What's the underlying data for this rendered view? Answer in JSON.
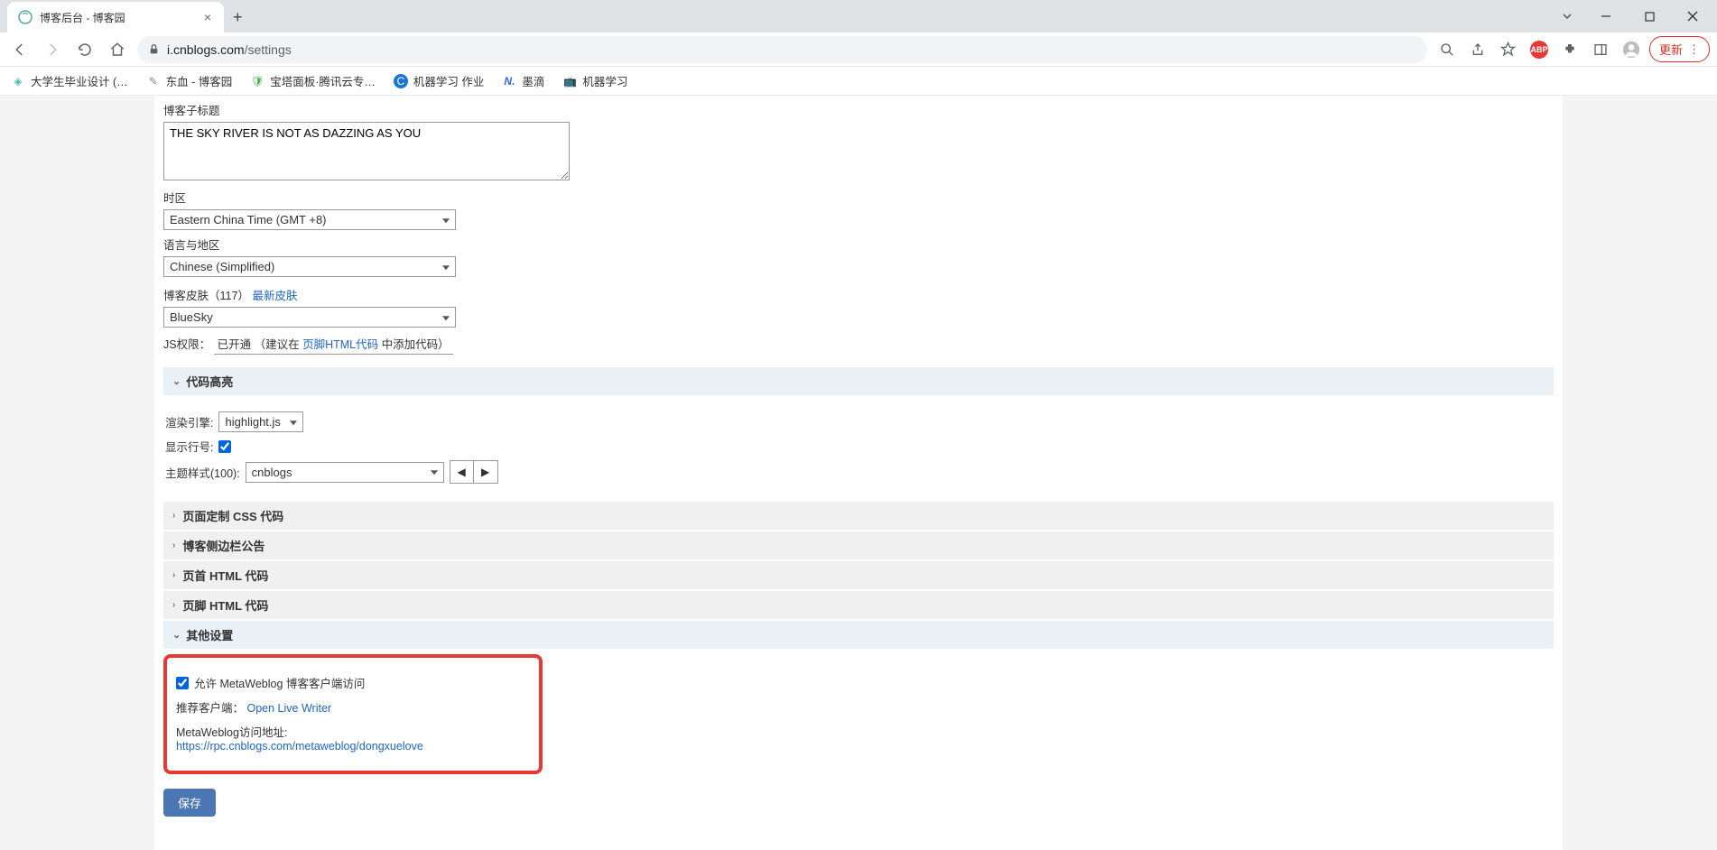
{
  "browser": {
    "tab_title": "博客后台 - 博客园",
    "url_domain": "i.cnblogs.com",
    "url_path": "/settings",
    "update_label": "更新"
  },
  "bookmarks": [
    {
      "label": "大学生毕业设计 (…"
    },
    {
      "label": "东血 - 博客园"
    },
    {
      "label": "宝塔面板·腾讯云专…"
    },
    {
      "label": "机器学习 作业"
    },
    {
      "label": "墨滴"
    },
    {
      "label": "机器学习"
    }
  ],
  "form": {
    "subtitle_label": "博客子标题",
    "subtitle_value": "THE SKY RIVER IS NOT AS DAZZING AS YOU",
    "timezone_label": "时区",
    "timezone_value": "Eastern China Time (GMT +8)",
    "locale_label": "语言与地区",
    "locale_value": "Chinese (Simplified)",
    "skin_label": "博客皮肤",
    "skin_count": "（117）",
    "latest_skin": "最新皮肤",
    "skin_value": "BlueSky",
    "js_perm_label": "JS权限：",
    "js_status": "已开通",
    "js_suggest_prefix": "（建议在 ",
    "js_suggest_link": "页脚HTML代码",
    "js_suggest_suffix": " 中添加代码）"
  },
  "sections": {
    "highlight": "代码高亮",
    "render_label": "渲染引擎:",
    "render_value": "highlight.js",
    "lineno_label": "显示行号:",
    "theme_label": "主题样式(100):",
    "theme_value": "cnblogs",
    "css": "页面定制 CSS 代码",
    "sidebar": "博客侧边栏公告",
    "head_html": "页首 HTML 代码",
    "foot_html": "页脚 HTML 代码",
    "other": "其他设置"
  },
  "meta": {
    "allow_label": "允许 MetaWeblog 博客客户端访问",
    "client_label": "推荐客户端：",
    "client_link": "Open Live Writer",
    "addr_label": "MetaWeblog访问地址: ",
    "addr_link": "https://rpc.cnblogs.com/metaweblog/dongxuelove"
  },
  "save": "保存"
}
